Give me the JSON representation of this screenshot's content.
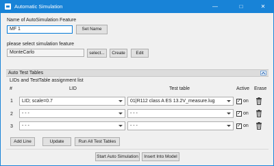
{
  "window": {
    "title": "Automatic Simulation"
  },
  "name_section": {
    "label": "Name of AutoSimulation Feature",
    "value": "MF 1",
    "set_button": "Set Name"
  },
  "feature_section": {
    "label": "please select simulation feature",
    "value": "MonteCarlo",
    "select_button": "select...",
    "create_button": "Create",
    "edit_button": "Edit"
  },
  "auto_tests": {
    "header": "Auto Test Tables",
    "list_title": "LIDs and TestTable assignment list",
    "columns": {
      "num": "#",
      "lid": "LID",
      "test_table": "Test table",
      "active": "Active",
      "erase": "Erase"
    },
    "rows": [
      {
        "num": "1",
        "lid": "LID; scale=0.7",
        "test_table": "01|R112 class A ES 13.2V_measure.lug",
        "active_label": "on"
      },
      {
        "num": "2",
        "lid": "- - -",
        "test_table": "- - -",
        "active_label": "on"
      },
      {
        "num": "3",
        "lid": "- - -",
        "test_table": "- - -",
        "active_label": "on"
      }
    ]
  },
  "actions": {
    "add_line": "Add Line",
    "update": "Update",
    "run_all": "Run All Test Tables",
    "start": "Start Auto Simulation",
    "insert": "Insert Into Model"
  },
  "colors": {
    "titlebar": "#1883d7",
    "background": "#f0f0f0",
    "section": "#dcdcdc"
  }
}
